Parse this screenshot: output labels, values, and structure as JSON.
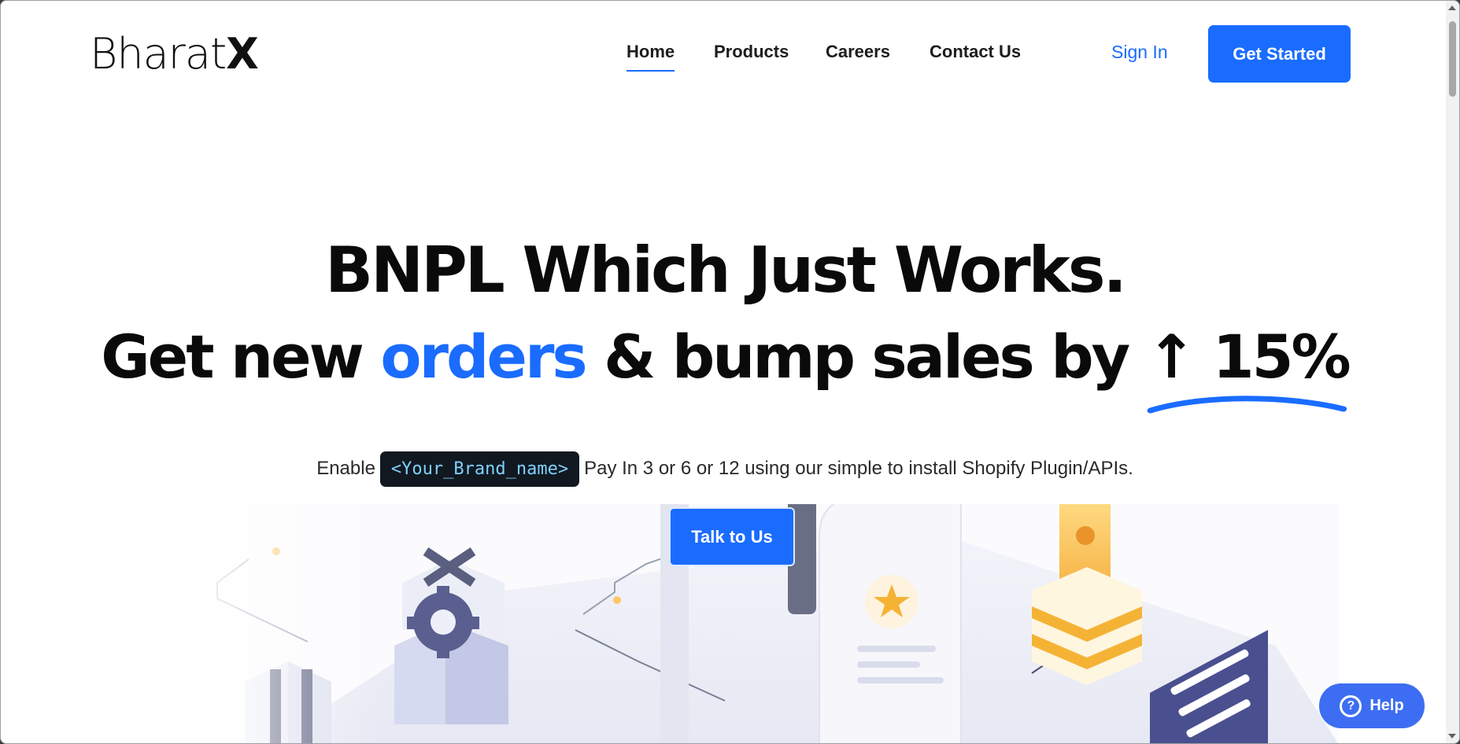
{
  "header": {
    "logo_text": "Bharat",
    "logo_x": "X",
    "nav": [
      {
        "label": "Home",
        "active": true
      },
      {
        "label": "Products",
        "active": false
      },
      {
        "label": "Careers",
        "active": false
      },
      {
        "label": "Contact Us",
        "active": false
      }
    ],
    "sign_in": "Sign In",
    "get_started": "Get Started"
  },
  "hero": {
    "line1": "BNPL Which Just Works.",
    "line2_pre": "Get new ",
    "line2_highlight": "orders",
    "line2_mid": " & bump sales by ",
    "line2_pct": "↑ 15%",
    "sub_pre": "Enable",
    "sub_code": "<Your_Brand_name>",
    "sub_post": "Pay In 3 or 6 or 12 using our simple to install Shopify Plugin/APIs.",
    "cta": "Talk to Us"
  },
  "help": {
    "label": "Help",
    "icon": "question-icon"
  },
  "colors": {
    "accent": "#1a6cff",
    "dark_chip": "#111820",
    "help": "#3d6df2"
  }
}
